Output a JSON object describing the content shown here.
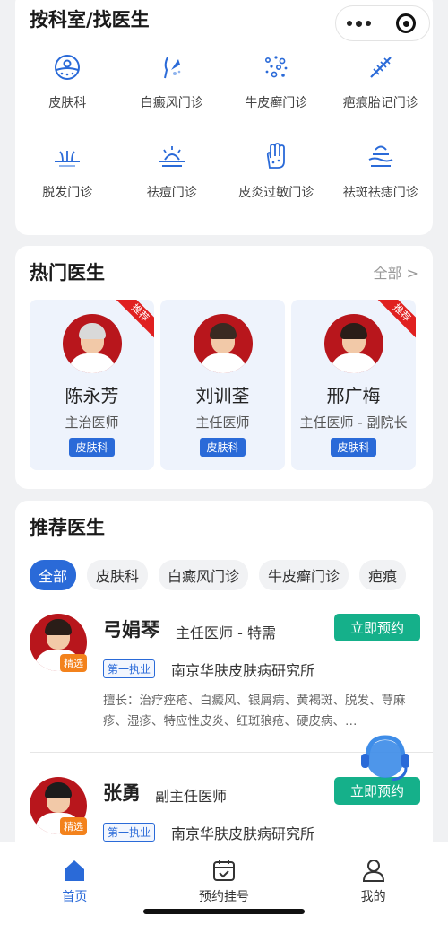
{
  "dept_section": {
    "title": "按科室/找医生",
    "items": [
      {
        "label": "皮肤科",
        "icon": "skin-icon"
      },
      {
        "label": "白癜风门诊",
        "icon": "vitiligo-icon"
      },
      {
        "label": "牛皮癣门诊",
        "icon": "psoriasis-icon"
      },
      {
        "label": "疤痕胎记门诊",
        "icon": "scar-icon"
      },
      {
        "label": "脱发门诊",
        "icon": "hair-loss-icon"
      },
      {
        "label": "祛痘门诊",
        "icon": "acne-icon"
      },
      {
        "label": "皮炎过敏门诊",
        "icon": "allergy-icon"
      },
      {
        "label": "祛斑祛痣门诊",
        "icon": "spot-removal-icon"
      }
    ]
  },
  "hot_section": {
    "title": "热门医生",
    "more": "全部 >",
    "doctors": [
      {
        "name": "陈永芳",
        "title": "主治医师",
        "dept": "皮肤科",
        "ribbon": "推荐"
      },
      {
        "name": "刘训荃",
        "title": "主任医师",
        "dept": "皮肤科"
      },
      {
        "name": "邢广梅",
        "title": "主任医师 - 副院长",
        "dept": "皮肤科",
        "ribbon": "推荐"
      }
    ]
  },
  "rec_section": {
    "title": "推荐医生",
    "chips": [
      "全部",
      "皮肤科",
      "白癜风门诊",
      "牛皮癣门诊",
      "疤痕"
    ],
    "doctors": [
      {
        "name": "弓娟琴",
        "title": "主任医师 - 特需",
        "badge": "精选",
        "book": "立即预约",
        "tag": "第一执业",
        "hospital": "南京华肤皮肤病研究所",
        "skill": "擅长：治疗痤疮、白癜风、银屑病、黄褐斑、脱发、荨麻疹、湿疹、特应性皮炎、红斑狼疮、硬皮病、…"
      },
      {
        "name": "张勇",
        "title": "副主任医师",
        "badge": "精选",
        "book": "立即预约",
        "tag": "第一执业",
        "hospital": "南京华肤皮肤病研究所"
      }
    ]
  },
  "tabbar": {
    "tabs": [
      {
        "label": "首页",
        "icon": "home-icon",
        "active": true
      },
      {
        "label": "预约挂号",
        "icon": "calendar-check-icon"
      },
      {
        "label": "我的",
        "icon": "user-icon"
      }
    ]
  },
  "colors": {
    "accent": "#2a6ad8",
    "book": "#15b08a",
    "ribbon": "#e02020",
    "badge": "#f3821c"
  }
}
